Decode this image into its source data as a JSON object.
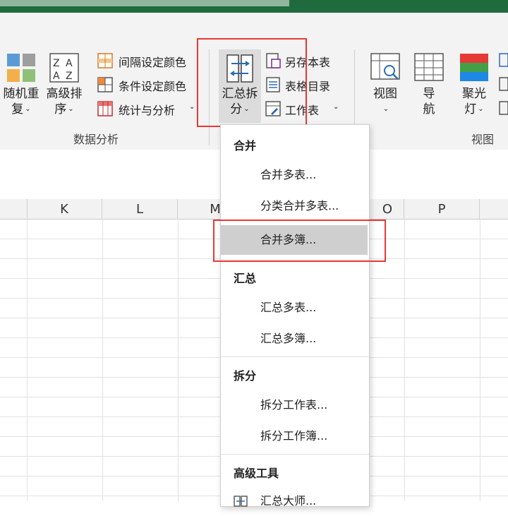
{
  "ribbon": {
    "data_analysis": {
      "group_label": "数据分析",
      "random_reorder": {
        "line1": "随机重",
        "line2": "复"
      },
      "advanced_sort": {
        "line1": "高级排",
        "line2": "序"
      },
      "interval_color": "间隔设定颜色",
      "condition_color": "条件设定颜色",
      "stats_analysis": "统计与分析"
    },
    "merge_split": {
      "line1": "汇总拆",
      "line2": "分",
      "save_sheet": "另存本表",
      "sheet_index": "表格目录",
      "worksheet": "工作表"
    },
    "view": {
      "group_label": "视图",
      "view_btn": "视图",
      "nav": {
        "line1": "导",
        "line2": "航"
      },
      "spotlight": {
        "line1": "聚光",
        "line2": "灯"
      }
    }
  },
  "sheet": {
    "columns": [
      "K",
      "L",
      "M",
      "O",
      "P"
    ]
  },
  "menu": {
    "merge_header": "合并",
    "merge_items": [
      "合并多表...",
      "分类合并多表...",
      "合并多簿..."
    ],
    "summary_header": "汇总",
    "summary_items": [
      "汇总多表...",
      "汇总多簿..."
    ],
    "split_header": "拆分",
    "split_items": [
      "拆分工作表...",
      "拆分工作簿..."
    ],
    "advanced_header": "高级工具",
    "advanced_items": [
      "汇总大师..."
    ]
  },
  "colors": {
    "accent_green": "#1f6b3d",
    "highlight_red": "#e53935",
    "menu_hover": "#cfcfcf"
  }
}
